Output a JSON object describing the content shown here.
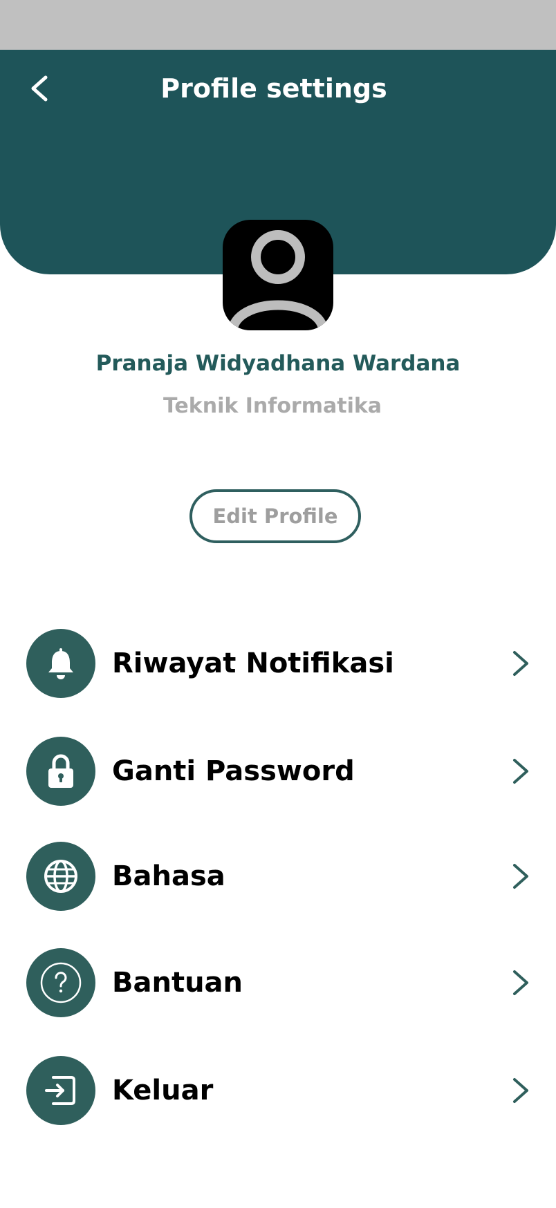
{
  "header": {
    "title": "Profile settings",
    "back_icon": "chevron-left-icon",
    "background_color": "#1e5459"
  },
  "profile": {
    "avatar_icon": "user-icon",
    "name": "Pranaja Widyadhana Wardana",
    "major": "Teknik Informatika",
    "edit_button_label": "Edit Profile"
  },
  "menu": {
    "items": [
      {
        "label": "Riwayat Notifikasi",
        "icon": "bell-icon"
      },
      {
        "label": "Ganti Password",
        "icon": "lock-icon"
      },
      {
        "label": "Bahasa",
        "icon": "globe-icon"
      },
      {
        "label": "Bantuan",
        "icon": "help-icon"
      },
      {
        "label": "Keluar",
        "icon": "logout-icon"
      }
    ],
    "icon_background": "#2f5f5c",
    "chevron_icon": "chevron-right-icon"
  }
}
